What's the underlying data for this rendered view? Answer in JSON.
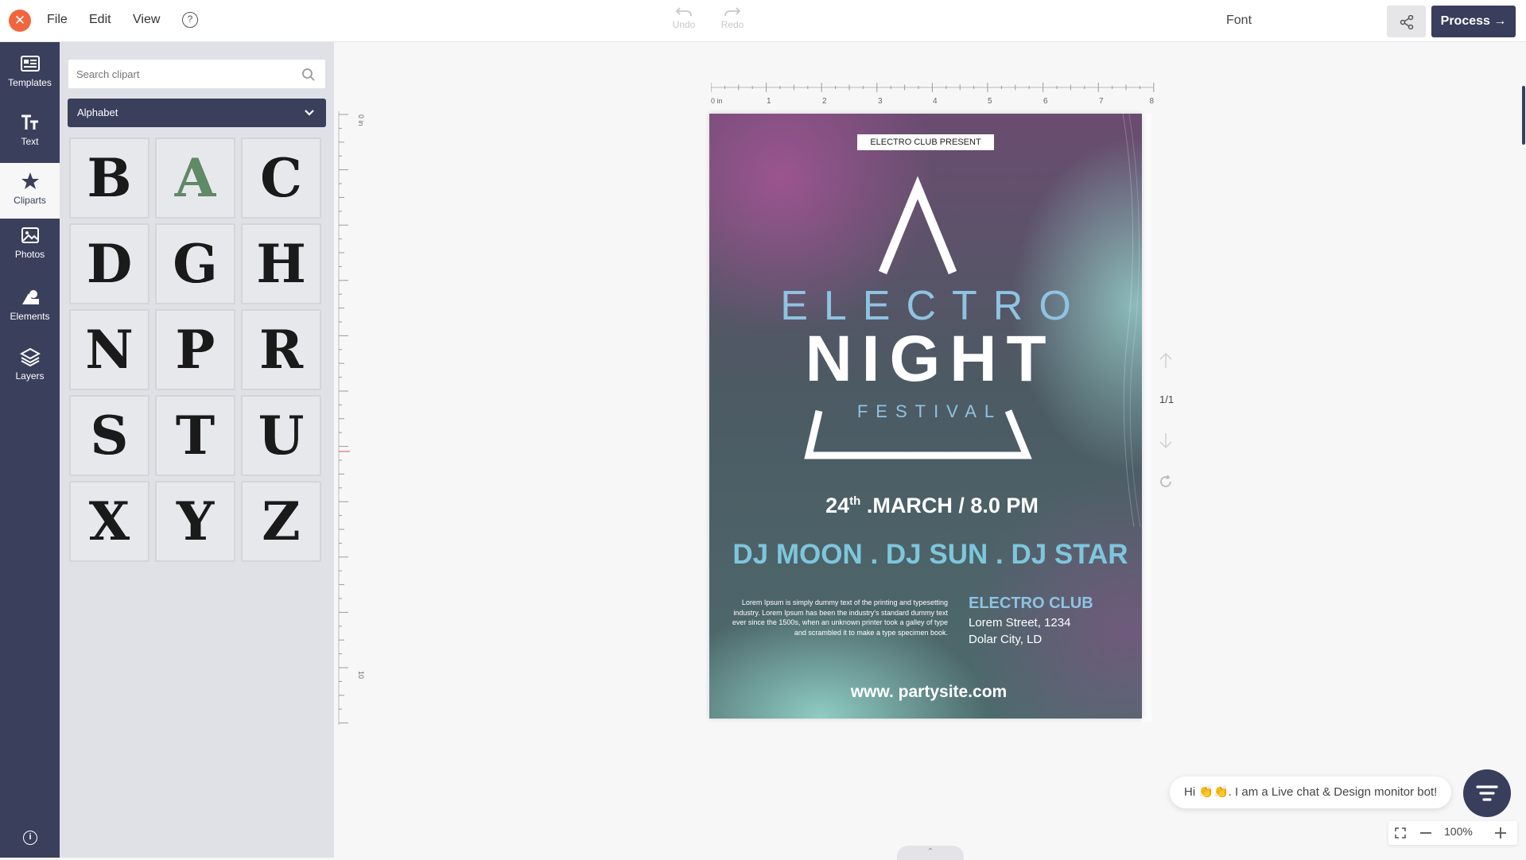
{
  "topbar": {
    "menu": [
      "File",
      "Edit",
      "View"
    ],
    "undo_label": "Undo",
    "redo_label": "Redo",
    "font_label": "Font",
    "process_label": "Process →"
  },
  "nav": {
    "items": [
      {
        "label": "Templates",
        "icon": "templates-icon"
      },
      {
        "label": "Text",
        "icon": "text-icon"
      },
      {
        "label": "Cliparts",
        "icon": "star-icon"
      },
      {
        "label": "Photos",
        "icon": "photo-icon"
      },
      {
        "label": "Elements",
        "icon": "shapes-icon"
      },
      {
        "label": "Layers",
        "icon": "layers-icon"
      }
    ],
    "active": "Cliparts"
  },
  "panel": {
    "search_placeholder": "Search clipart",
    "category": "Alphabet",
    "letters": [
      "B",
      "A",
      "C",
      "D",
      "G",
      "H",
      "N",
      "P",
      "R",
      "S",
      "T",
      "U",
      "X",
      "Y",
      "Z"
    ]
  },
  "rulers": {
    "horizontal": [
      "0 in",
      "1",
      "2",
      "3",
      "4",
      "5",
      "6",
      "7",
      "8"
    ],
    "vertical": [
      "0 in",
      "10"
    ]
  },
  "poster": {
    "badge": "ELECTRO CLUB PRESENT",
    "electro": "ELECTRO",
    "night": "NIGHT",
    "festival": "FESTIVAL",
    "date_day": "24",
    "date_suffix": "th",
    "date_rest": " .MARCH / 8.0 PM",
    "djs": "DJ MOON . DJ SUN . DJ STAR",
    "lorem": "Lorem Ipsum is simply dummy text of the printing and typesetting industry. Lorem Ipsum has been the industry's standard dummy text ever since the 1500s, when an unknown printer took a galley of type and scrambled it to make a type specimen book.",
    "club_name": "ELECTRO CLUB",
    "address_line1": "Lorem Street, 1234",
    "address_line2": "Dolar City, LD",
    "website": "www. partysite.com"
  },
  "page_indicator": "1/1",
  "chat": {
    "message": "Hi 👏👏. I am a Live chat & Design monitor bot!"
  },
  "zoom": {
    "level": "100%"
  },
  "colors": {
    "accent": "#f0663f",
    "nav_bg": "#3a3f5c",
    "process_bg": "#383e5c",
    "poster_blue": "#8fc3e2"
  }
}
